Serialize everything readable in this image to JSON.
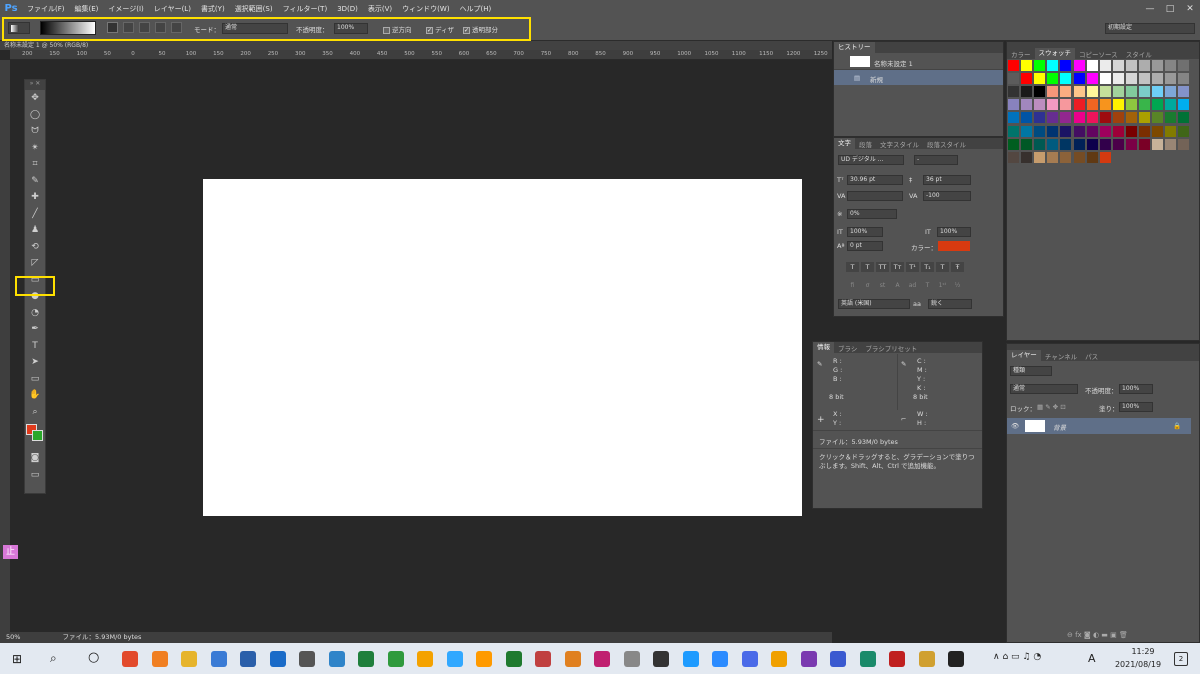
{
  "app": {
    "logo": "Ps"
  },
  "menu": [
    "ファイル(F)",
    "編集(E)",
    "イメージ(I)",
    "レイヤー(L)",
    "書式(Y)",
    "選択範囲(S)",
    "フィルター(T)",
    "3D(D)",
    "表示(V)",
    "ウィンドウ(W)",
    "ヘルプ(H)"
  ],
  "window_controls": [
    "—",
    "□",
    "✕"
  ],
  "options": {
    "mode_label": "モード：",
    "mode_value": "通常",
    "opacity_label": "不透明度：",
    "opacity_value": "100%",
    "reverse_label": "逆方向",
    "dither_label": "ディザ",
    "transparency_label": "透明部分",
    "workspace": "初期設定"
  },
  "document": {
    "tab": "名称未設定 1 @ 50% (RGB/8)"
  },
  "ruler": {
    "h_ticks": [
      "200",
      "150",
      "100",
      "50",
      "0",
      "50",
      "100",
      "150",
      "200",
      "250",
      "300",
      "350",
      "400",
      "450",
      "500",
      "550",
      "600",
      "650",
      "700",
      "750",
      "800",
      "850",
      "900",
      "950",
      "1000",
      "1050",
      "1100",
      "1150",
      "1200",
      "1250"
    ]
  },
  "tools": [
    "move-tool",
    "marquee-tool",
    "lasso-tool",
    "magic-wand-tool",
    "crop-tool",
    "eyedropper-tool",
    "healing-tool",
    "brush-tool",
    "stamp-tool",
    "history-brush-tool",
    "eraser-tool",
    "gradient-tool",
    "blur-tool",
    "dodge-tool",
    "pen-tool",
    "type-tool",
    "path-select-tool",
    "shape-tool",
    "hand-tool",
    "zoom-tool"
  ],
  "colors": {
    "foreground": "#e03a1c",
    "background": "#2aa82a",
    "highlight": "#ffe000",
    "accent": "#4ea4ff"
  },
  "history": {
    "tab": "ヒストリー",
    "snapshot": "名称未設定 1",
    "state": "新規"
  },
  "character": {
    "tabs": [
      "文字",
      "段落",
      "文字スタイル",
      "段落スタイル"
    ],
    "font": "UD デジタル ...",
    "style": "-",
    "size": "30.96 pt",
    "leading": "36 pt",
    "tracking": "-100",
    "scale_pct": "0%",
    "vscale": "100%",
    "hscale": "100%",
    "baseline": "0 pt",
    "color_label": "カラー：",
    "color_swatch": "#d83a10",
    "lang": "英語 (米国)",
    "aa_label": "aa",
    "aa": "鋭く"
  },
  "info": {
    "tabs": [
      "情報",
      "ブラシ",
      "ブラシプリセット"
    ],
    "rgb": [
      "R :",
      "G :",
      "B :"
    ],
    "cmyk": [
      "C :",
      "M :",
      "Y :",
      "K :"
    ],
    "bit1": "8 bit",
    "bit2": "8 bit",
    "xy": [
      "X :",
      "Y :"
    ],
    "wh": [
      "W :",
      "H :"
    ],
    "file": "ファイル：5.93M/0 bytes",
    "hint": "クリック＆ドラッグすると、グラデーションで塗りつぶします。Shift、Alt、Ctrl で追加機能。"
  },
  "swatches": {
    "tabs": [
      "カラー",
      "スウォッチ",
      "コピーソース",
      "スタイル"
    ],
    "rows": [
      [
        "#ff0000",
        "#ffff00",
        "#00ff00",
        "#00ffff",
        "#0000ff",
        "#ff00ff",
        "#ffffff",
        "#ebebeb",
        "#d6d6d6",
        "#c2c2c2",
        "#adadad",
        "#999999",
        "#858585",
        "#707070"
      ],
      [
        "#5c5c5c",
        "#ff0000",
        "#ffff00",
        "#00ff00",
        "#00ffff",
        "#0000ff",
        "#ff00ff",
        "#ffffff",
        "#ebebeb",
        "#d6d6d6",
        "#c2c2c2",
        "#adadad",
        "#999999",
        "#858585"
      ],
      [
        "#333333",
        "#1a1a1a",
        "#000000",
        "#f7977a",
        "#f9ad81",
        "#fdc68a",
        "#fff79a",
        "#c4df9b",
        "#a2d39c",
        "#82ca9d",
        "#7bcdc8",
        "#6ecff6",
        "#7ea7d8",
        "#8493ca"
      ],
      [
        "#8882be",
        "#a187be",
        "#bc8dbf",
        "#f49ac2",
        "#f6989d",
        "#ed1c24",
        "#f26522",
        "#f7941d",
        "#fff200",
        "#8dc73f",
        "#39b54a",
        "#00a651",
        "#00a99d",
        "#00aeef"
      ],
      [
        "#0072bc",
        "#0054a6",
        "#2e3192",
        "#662d91",
        "#92278f",
        "#ec008c",
        "#ed145b",
        "#9e0b0f",
        "#a0410d",
        "#a36209",
        "#aba000",
        "#598527",
        "#1a7b30",
        "#007236"
      ],
      [
        "#00746b",
        "#0076a3",
        "#004b80",
        "#003471",
        "#1b1464",
        "#440e62",
        "#630460",
        "#9e005d",
        "#9e0039",
        "#790000",
        "#7b2e00",
        "#7d4900",
        "#827b00",
        "#406618"
      ],
      [
        "#005e20",
        "#005826",
        "#005952",
        "#005b7f",
        "#003663",
        "#002157",
        "#0d004c",
        "#32004b",
        "#4b0049",
        "#7b0046",
        "#7a0026",
        "#c7b299",
        "#998675",
        "#736357"
      ],
      [
        "#534741",
        "#37302d",
        "#c69c6d",
        "#a67c52",
        "#8c6239",
        "#754c24",
        "#603913",
        "#d43a10"
      ]
    ]
  },
  "layers": {
    "tabs": [
      "レイヤー",
      "チャンネル",
      "パス"
    ],
    "filter": "種類",
    "blend": "通常",
    "opacity_label": "不透明度：",
    "opacity": "100%",
    "lock_label": "ロック：",
    "fill_label": "塗り：",
    "fill": "100%",
    "layer_name": "背景"
  },
  "status": {
    "zoom": "50%",
    "file": "ファイル：5.93M/0 bytes"
  },
  "taskbar": {
    "time": "11:29",
    "date": "2021/08/19",
    "ime": "A",
    "notif": "2"
  }
}
